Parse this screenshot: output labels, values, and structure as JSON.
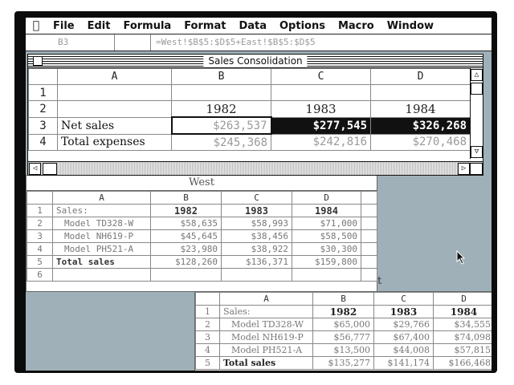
{
  "menubar": {
    "items": [
      "File",
      "Edit",
      "Formula",
      "Format",
      "Data",
      "Options",
      "Macro",
      "Window"
    ]
  },
  "formula_bar": {
    "cell_ref": "B3",
    "formula": "=West!$B$5:$D$5+East!$B$5:$D$5"
  },
  "main_window": {
    "title": "Sales Consolidation",
    "columns": [
      "A",
      "B",
      "C",
      "D"
    ],
    "rows": [
      {
        "num": "1",
        "label": "",
        "values": [
          "",
          "",
          ""
        ]
      },
      {
        "num": "2",
        "label": "",
        "values": [
          "1982",
          "1983",
          "1984"
        ]
      },
      {
        "num": "3",
        "label": "Net sales",
        "values": [
          "$263,537",
          "$277,545",
          "$326,268"
        ]
      },
      {
        "num": "4",
        "label": "Total expenses",
        "values": [
          "$245,368",
          "$242,816",
          "$270,468"
        ]
      }
    ]
  },
  "west_window": {
    "title": "West",
    "columns": [
      "A",
      "B",
      "C",
      "D"
    ],
    "rows": [
      {
        "num": "1",
        "label": "Sales:",
        "values": [
          "1982",
          "1983",
          "1984"
        ]
      },
      {
        "num": "2",
        "label": "Model TD328-W",
        "values": [
          "$58,635",
          "$58,993",
          "$71,000"
        ]
      },
      {
        "num": "3",
        "label": "Model NH619-P",
        "values": [
          "$45,645",
          "$38,456",
          "$58,500"
        ]
      },
      {
        "num": "4",
        "label": "Model PH521-A",
        "values": [
          "$23,980",
          "$38,922",
          "$30,300"
        ]
      },
      {
        "num": "5",
        "label": "Total sales",
        "values": [
          "$128,260",
          "$136,371",
          "$159,800"
        ]
      },
      {
        "num": "6",
        "label": "",
        "values": [
          "",
          "",
          ""
        ]
      }
    ]
  },
  "east_window": {
    "title_fragment": "t",
    "columns": [
      "A",
      "B",
      "C",
      "D"
    ],
    "rows": [
      {
        "num": "1",
        "label": "Sales:",
        "values": [
          "1982",
          "1983",
          "1984"
        ]
      },
      {
        "num": "2",
        "label": "Model TD328-W",
        "values": [
          "$65,000",
          "$29,766",
          "$34,555"
        ]
      },
      {
        "num": "3",
        "label": "Model NH619-P",
        "values": [
          "$56,777",
          "$67,400",
          "$74,098"
        ]
      },
      {
        "num": "4",
        "label": "Model PH521-A",
        "values": [
          "$13,500",
          "$44,008",
          "$57,815"
        ]
      },
      {
        "num": "5",
        "label": "Total sales",
        "values": [
          "$135,277",
          "$141,174",
          "$166,468"
        ]
      }
    ]
  },
  "icons": {
    "apple": "apple-icon",
    "cursor": "arrow-cursor-icon"
  }
}
